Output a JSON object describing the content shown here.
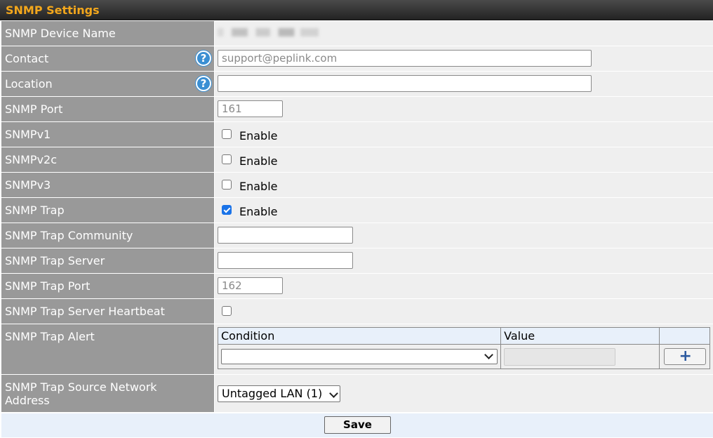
{
  "title": "SNMP Settings",
  "fields": {
    "device_name": {
      "label": "SNMP Device Name"
    },
    "contact": {
      "label": "Contact",
      "placeholder": "support@peplink.com",
      "value": ""
    },
    "location": {
      "label": "Location",
      "value": ""
    },
    "port": {
      "label": "SNMP Port",
      "placeholder": "161"
    },
    "v1": {
      "label": "SNMPv1",
      "option": "Enable",
      "checked": false
    },
    "v2c": {
      "label": "SNMPv2c",
      "option": "Enable",
      "checked": false
    },
    "v3": {
      "label": "SNMPv3",
      "option": "Enable",
      "checked": false
    },
    "trap": {
      "label": "SNMP Trap",
      "option": "Enable",
      "checked": true
    },
    "trap_community": {
      "label": "SNMP Trap Community",
      "value": ""
    },
    "trap_server": {
      "label": "SNMP Trap Server",
      "value": ""
    },
    "trap_port": {
      "label": "SNMP Trap Port",
      "placeholder": "162"
    },
    "trap_heartbeat": {
      "label": "SNMP Trap Server Heartbeat",
      "checked": false
    },
    "trap_alert": {
      "label": "SNMP Trap Alert",
      "col_condition": "Condition",
      "col_value": "Value",
      "condition_selected": ""
    },
    "trap_source": {
      "label": "SNMP Trap Source Network Address",
      "selected": "Untagged LAN (1)"
    }
  },
  "help_glyph": "?",
  "add_glyph": "+",
  "save_label": "Save"
}
